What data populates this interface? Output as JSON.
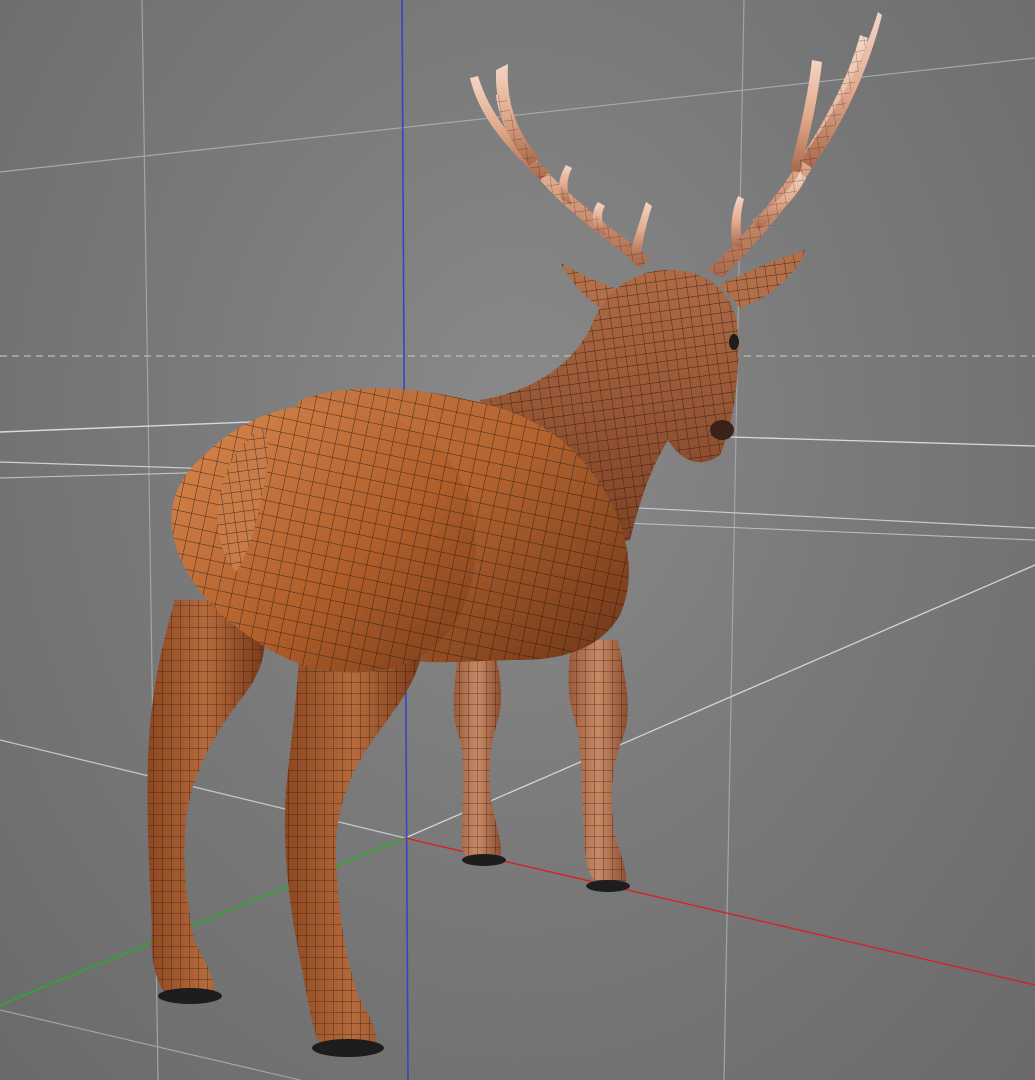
{
  "viewport": {
    "label": "",
    "background_color": "#7a7a7a",
    "grid_color": "#a9a9a9",
    "grid_bright_color": "#d8d8d8",
    "horizon_dashed_color": "#bdbdbd"
  },
  "axes": {
    "x_axis_color": "#d92020",
    "y_axis_color": "#3d40c8",
    "z_axis_color": "#22b122"
  },
  "model": {
    "subject": "deer",
    "body_color": "#a35a2e",
    "body_highlight_color": "#d68b52",
    "antler_color": "#e7b79c",
    "wireframe_color": "#1a1410",
    "hoof_color": "#1d1d1d",
    "display_mode": "shaded-with-wireframe"
  }
}
